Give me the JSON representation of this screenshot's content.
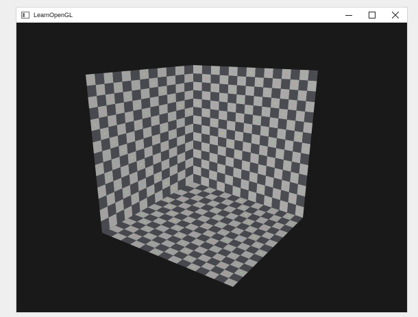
{
  "window": {
    "title": "LearnOpenGL",
    "icon": "app-window-icon",
    "controls": [
      {
        "name": "minimize",
        "icon": "minimize-icon"
      },
      {
        "name": "maximize",
        "icon": "maximize-icon"
      },
      {
        "name": "close",
        "icon": "close-icon"
      }
    ]
  },
  "viewport": {
    "background": "#191919",
    "scene": "checkerboard-room-corner",
    "tile_light": "#a9aaa8",
    "tile_dark": "#4b4b52",
    "grid": {
      "left_wall": [
        12,
        14
      ],
      "back_wall": [
        14,
        14
      ],
      "floor": [
        14,
        14
      ]
    }
  }
}
